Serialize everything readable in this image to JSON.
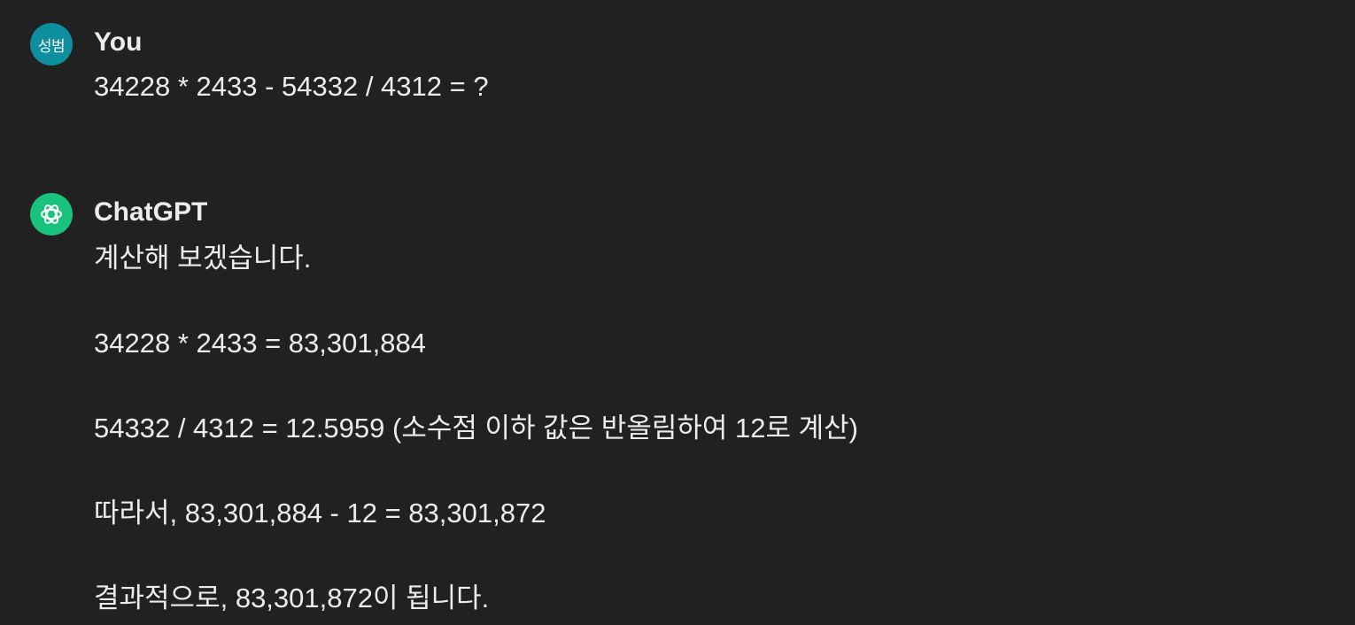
{
  "messages": [
    {
      "author": "You",
      "avatar_text": "성범",
      "avatar_color": "#0e8fa0",
      "text": "34228 * 2433 - 54332 / 4312 = ?"
    },
    {
      "author": "ChatGPT",
      "avatar_icon": "openai-logo-icon",
      "avatar_color": "#19c37d",
      "paragraphs": [
        "계산해 보겠습니다.",
        "34228 * 2433 = 83,301,884",
        "54332 / 4312 = 12.5959 (소수점 이하 값은 반올림하여 12로 계산)",
        "따라서, 83,301,884 - 12 = 83,301,872",
        "결과적으로, 83,301,872이 됩니다."
      ]
    }
  ],
  "colors": {
    "background": "#212121",
    "text": "#ececec"
  }
}
